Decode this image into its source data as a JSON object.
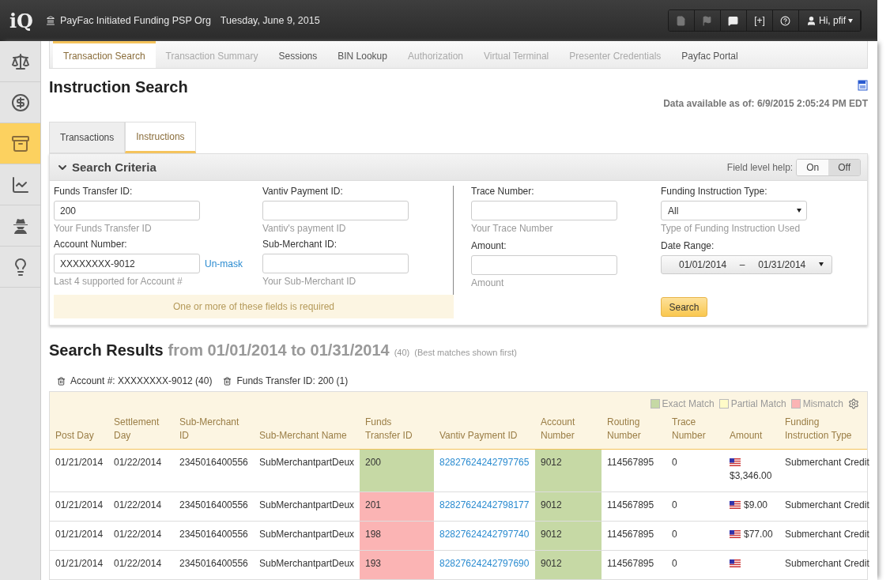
{
  "top_bar": {
    "logo": "iQ",
    "org": "PayFac Initiated Funding PSP Org",
    "date": "Tuesday, June 9, 2015",
    "tools": [
      {
        "kind": "document",
        "disabled": true
      },
      {
        "kind": "flag",
        "disabled": true
      },
      {
        "kind": "comment",
        "disabled": false
      },
      {
        "kind": "text",
        "label": "[+]",
        "disabled": false
      },
      {
        "kind": "help",
        "disabled": false
      }
    ],
    "user": "Hi, pfif"
  },
  "sidebar": {
    "items": [
      {
        "kind": "scale",
        "selected": false
      },
      {
        "kind": "money",
        "selected": false
      },
      {
        "kind": "cabinet",
        "selected": true
      },
      {
        "kind": "chart",
        "selected": false
      },
      {
        "kind": "spy",
        "selected": false
      },
      {
        "kind": "bulb",
        "selected": false
      }
    ]
  },
  "nav_tabs": [
    {
      "label": "Transaction Search",
      "selected": true,
      "disabled": false
    },
    {
      "label": "Transaction Summary",
      "selected": false,
      "disabled": true
    },
    {
      "label": "Sessions",
      "selected": false,
      "disabled": false
    },
    {
      "label": "BIN Lookup",
      "selected": false,
      "disabled": false
    },
    {
      "label": "Authorization",
      "selected": false,
      "disabled": true
    },
    {
      "label": "Virtual Terminal",
      "selected": false,
      "disabled": true
    },
    {
      "label": "Presenter Credentials",
      "selected": false,
      "disabled": true
    },
    {
      "label": "Payfac Portal",
      "selected": false,
      "disabled": false
    }
  ],
  "page_title": "Instruction Search",
  "data_available": "Data available as of: 6/9/2015 2:05:24 PM EDT",
  "search_tabs": [
    {
      "label": "Transactions",
      "selected": false
    },
    {
      "label": "Instructions",
      "selected": true
    }
  ],
  "search_criteria": {
    "title": "Search Criteria",
    "expanded": true,
    "help_label": "Field level help:",
    "help_toggle": [
      {
        "label": "On",
        "selected": false
      },
      {
        "label": "Off",
        "selected": true
      }
    ],
    "left_fields": [
      {
        "label": "Funds Transfer ID:",
        "value": "200",
        "hint": "Your Funds Transfer ID"
      },
      {
        "label": "Vantiv Payment ID:",
        "hint": "Vantiv's payment ID"
      },
      {
        "label": "Account Number:",
        "value": "XXXXXXXX-9012",
        "hint": "Last 4 supported for Account #",
        "link": "Un-mask"
      },
      {
        "label": "Sub-Merchant ID:",
        "hint": "Your Sub-Merchant ID"
      }
    ],
    "required_note": "One or more of these fields is required",
    "trace": {
      "label": "Trace Number:",
      "hint": "Your Trace Number"
    },
    "instruction_type": {
      "label": "Funding Instruction Type:",
      "value": "All",
      "hint": "Type of Funding Instruction Used"
    },
    "amount": {
      "label": "Amount:",
      "hint": "Amount"
    },
    "date_range": {
      "label": "Date Range:",
      "from": "01/01/2014",
      "separator": "–",
      "to": "01/31/2014"
    },
    "search_button": "Search"
  },
  "results": {
    "title": "Search Results",
    "range": "from 01/01/2014 to 01/31/2014",
    "count": "(40)",
    "note": "(Best matches shown first)",
    "filters": [
      "Account #: XXXXXXXX-9012 (40)",
      "Funds Transfer ID: 200 (1)"
    ],
    "legend": [
      {
        "label": "Exact Match",
        "color": "#c6d9a5"
      },
      {
        "label": "Partial Match",
        "color": "#fffbc8"
      },
      {
        "label": "Mismatch",
        "color": "#fbb4b4"
      }
    ],
    "columns": [
      "Post Day",
      "Settlement Day",
      "Sub-Merchant ID",
      "Sub-Merchant Name",
      "Funds Transfer ID",
      "Vantiv Payment ID",
      "Account Number",
      "Routing Number",
      "Trace Number",
      "Amount",
      "Funding Instruction Type"
    ],
    "rows": [
      {
        "cells": [
          {
            "text": "01/21/2014"
          },
          {
            "text": "01/22/2014"
          },
          {
            "text": "2345016400556"
          },
          {
            "text": "SubMerchantpartDeux"
          },
          {
            "text": "200",
            "color": "#c6d9a5"
          },
          {
            "text": "82827624242797765",
            "kind": "link"
          },
          {
            "text": "9012",
            "color": "#c6d9a5"
          },
          {
            "text": "114567895"
          },
          {
            "text": "0"
          },
          {
            "text": "$3,346.00",
            "kind": "amount",
            "wrap": true
          },
          {
            "text": "Submerchant Credit"
          }
        ]
      },
      {
        "cells": [
          {
            "text": "01/21/2014"
          },
          {
            "text": "01/22/2014"
          },
          {
            "text": "2345016400556"
          },
          {
            "text": "SubMerchantpartDeux"
          },
          {
            "text": "201",
            "color": "#fbb4b4"
          },
          {
            "text": "82827624242798177",
            "kind": "link"
          },
          {
            "text": "9012",
            "color": "#c6d9a5"
          },
          {
            "text": "114567895"
          },
          {
            "text": "0"
          },
          {
            "text": "$9.00",
            "kind": "amount"
          },
          {
            "text": "Submerchant Credit"
          }
        ]
      },
      {
        "cells": [
          {
            "text": "01/21/2014"
          },
          {
            "text": "01/22/2014"
          },
          {
            "text": "2345016400556"
          },
          {
            "text": "SubMerchantpartDeux"
          },
          {
            "text": "198",
            "color": "#fbb4b4"
          },
          {
            "text": "82827624242797740",
            "kind": "link"
          },
          {
            "text": "9012",
            "color": "#c6d9a5"
          },
          {
            "text": "114567895"
          },
          {
            "text": "0"
          },
          {
            "text": "$77.00",
            "kind": "amount"
          },
          {
            "text": "Submerchant Credit"
          }
        ]
      },
      {
        "cells": [
          {
            "text": "01/21/2014"
          },
          {
            "text": "01/22/2014"
          },
          {
            "text": "2345016400556"
          },
          {
            "text": "SubMerchantpartDeux"
          },
          {
            "text": "193",
            "color": "#fbb4b4"
          },
          {
            "text": "82827624242797690",
            "kind": "link"
          },
          {
            "text": "9012",
            "color": "#c6d9a5"
          },
          {
            "text": "114567895"
          },
          {
            "text": "0"
          },
          {
            "kind": "amount"
          },
          {
            "text": "Submerchant Credit"
          }
        ]
      }
    ]
  }
}
